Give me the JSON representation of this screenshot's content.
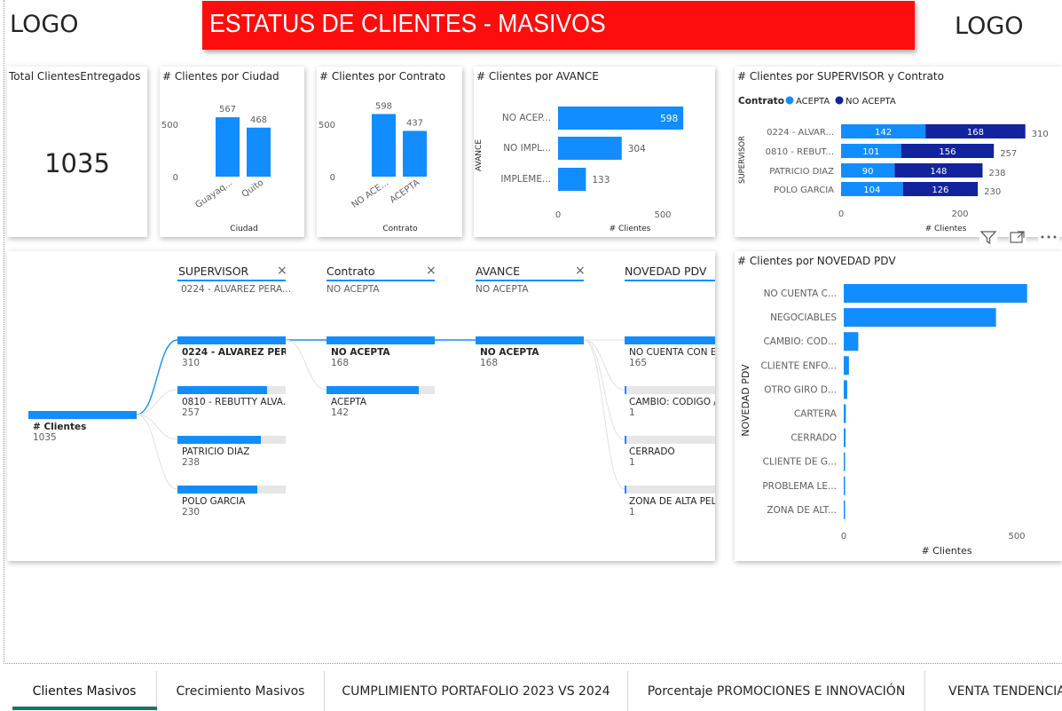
{
  "header": {
    "logo_left": "LOGO",
    "logo_right": "LOGO",
    "banner_title": "ESTATUS DE CLIENTES - MASIVOS",
    "banner_color": "#fd0d0d"
  },
  "colors": {
    "accent": "#118dff",
    "dark_accent": "#12239e",
    "track": "#e6e6e6",
    "active_tab": "#117865"
  },
  "kpi": {
    "title": "Total ClientesEntregados",
    "value": "1035"
  },
  "charts": {
    "ciudad": {
      "title": "# Clientes por Ciudad",
      "xlabel": "Ciudad",
      "ticks": [
        "500",
        "0"
      ],
      "categories": [
        "Guayaq...",
        "Quito"
      ],
      "values": [
        567,
        468
      ],
      "labels": [
        "567",
        "468"
      ]
    },
    "contrato": {
      "title": "# Clientes por Contrato",
      "xlabel": "Contrato",
      "ticks": [
        "500",
        "0"
      ],
      "categories": [
        "NO ACE...",
        "ACEPTA"
      ],
      "values": [
        598,
        437
      ],
      "labels": [
        "598",
        "437"
      ]
    },
    "avance": {
      "title": "# Clientes por AVANCE",
      "ylabel": "AVANCE",
      "xlabel": "# Clientes",
      "ticks": [
        "0",
        "500"
      ],
      "categories": [
        "NO ACEP...",
        "NO IMPL...",
        "IMPLEME..."
      ],
      "values": [
        598,
        304,
        133
      ],
      "labels": [
        "598",
        "304",
        "133"
      ]
    },
    "supervisor": {
      "title": "# Clientes por SUPERVISOR y Contrato",
      "legend_title": "Contrato",
      "legend": [
        "ACEPTA",
        "NO ACEPTA"
      ],
      "ylabel": "SUPERVISOR",
      "xlabel": "# Clientes",
      "ticks": [
        "0",
        "200"
      ],
      "categories": [
        "0224 - ALVAR...",
        "0810 - REBUT...",
        "PATRICIO DIAZ",
        "POLO GARCIA"
      ],
      "acepta": [
        142,
        101,
        90,
        104
      ],
      "no_acepta": [
        168,
        156,
        148,
        126
      ],
      "totals": [
        "310",
        "257",
        "238",
        "230"
      ],
      "acepta_labels": [
        "142",
        "101",
        "90",
        "104"
      ],
      "no_acepta_labels": [
        "168",
        "156",
        "148",
        "126"
      ]
    },
    "novedad": {
      "title": "# Clientes por NOVEDAD PDV",
      "ylabel": "NOVEDAD PDV",
      "xlabel": "# Clientes",
      "ticks": [
        "0",
        "500"
      ],
      "categories": [
        "NO CUENTA C...",
        "NEGOCIABLES",
        "CAMBIO: COD...",
        "CLIENTE ENFO...",
        "OTRO GIRO D...",
        "CARTERA",
        "CERRADO",
        "CLIENTE DE G...",
        "PROBLEMA LE...",
        "ZONA DE ALT..."
      ],
      "values": [
        530,
        440,
        42,
        15,
        10,
        6,
        5,
        3,
        2,
        2
      ]
    }
  },
  "chart_data": [
    {
      "type": "bar",
      "title": "# Clientes por Ciudad",
      "xlabel": "Ciudad",
      "categories": [
        "Guayaq...",
        "Quito"
      ],
      "values": [
        567,
        468
      ]
    },
    {
      "type": "bar",
      "title": "# Clientes por Contrato",
      "xlabel": "Contrato",
      "categories": [
        "NO ACE...",
        "ACEPTA"
      ],
      "values": [
        598,
        437
      ]
    },
    {
      "type": "bar",
      "title": "# Clientes por AVANCE",
      "ylabel": "AVANCE",
      "xlabel": "# Clientes",
      "categories": [
        "NO ACEP...",
        "NO IMPL...",
        "IMPLEME..."
      ],
      "values": [
        598,
        304,
        133
      ]
    },
    {
      "type": "bar",
      "title": "# Clientes por SUPERVISOR y Contrato",
      "ylabel": "SUPERVISOR",
      "xlabel": "# Clientes",
      "categories": [
        "0224 - ALVAR...",
        "0810 - REBUT...",
        "PATRICIO DIAZ",
        "POLO GARCIA"
      ],
      "series": [
        {
          "name": "ACEPTA",
          "values": [
            142,
            101,
            90,
            104
          ]
        },
        {
          "name": "NO ACEPTA",
          "values": [
            168,
            156,
            148,
            126
          ]
        }
      ]
    },
    {
      "type": "bar",
      "title": "# Clientes por NOVEDAD PDV",
      "ylabel": "NOVEDAD PDV",
      "xlabel": "# Clientes",
      "categories": [
        "NO CUENTA C...",
        "NEGOCIABLES",
        "CAMBIO: COD...",
        "CLIENTE ENFO...",
        "OTRO GIRO D...",
        "CARTERA",
        "CERRADO",
        "CLIENTE DE G...",
        "PROBLEMA LE...",
        "ZONA DE ALT..."
      ],
      "values": [
        530,
        440,
        42,
        15,
        10,
        6,
        5,
        3,
        2,
        2
      ]
    }
  ],
  "tree": {
    "columns": [
      {
        "header": "SUPERVISOR",
        "filter": "0224 - ALVAREZ PERA...",
        "closable": true
      },
      {
        "header": "Contrato",
        "filter": "NO ACEPTA",
        "closable": true
      },
      {
        "header": "AVANCE",
        "filter": "NO ACEPTA",
        "closable": true
      },
      {
        "header": "NOVEDAD PDV",
        "filter": "",
        "closable": false
      }
    ],
    "close_glyph": "×",
    "root": {
      "label": "# Clientes",
      "value": "1035"
    },
    "supervisor_nodes": [
      {
        "label": "0224 - ALVAREZ PER...",
        "value": "310",
        "fill": 1.0
      },
      {
        "label": "0810 - REBUTTY ALVA...",
        "value": "257",
        "fill": 0.83
      },
      {
        "label": "PATRICIO DIAZ",
        "value": "238",
        "fill": 0.77
      },
      {
        "label": "POLO GARCIA",
        "value": "230",
        "fill": 0.74
      }
    ],
    "contrato_nodes": [
      {
        "label": "NO ACEPTA",
        "value": "168",
        "fill": 1.0
      },
      {
        "label": "ACEPTA",
        "value": "142",
        "fill": 0.85
      }
    ],
    "avance_nodes": [
      {
        "label": "NO ACEPTA",
        "value": "168",
        "fill": 1.0
      }
    ],
    "novedad_nodes": [
      {
        "label": "NO CUENTA CON E",
        "value": "165",
        "fill": 1.0
      },
      {
        "label": "CAMBIO: CODIGO /",
        "value": "1",
        "fill": 0.01
      },
      {
        "label": "CERRADO",
        "value": "1",
        "fill": 0.01
      },
      {
        "label": "ZONA DE ALTA PEL",
        "value": "1",
        "fill": 0.01
      }
    ]
  },
  "tabs": [
    {
      "label": "Clientes Masivos",
      "active": true
    },
    {
      "label": "Crecimiento Masivos",
      "active": false
    },
    {
      "label": "CUMPLIMIENTO PORTAFOLIO 2023 VS 2024",
      "active": false
    },
    {
      "label": "Porcentaje PROMOCIONES E INNOVACIÓN",
      "active": false
    },
    {
      "label": "VENTA TENDENCIA",
      "active": false
    }
  ]
}
